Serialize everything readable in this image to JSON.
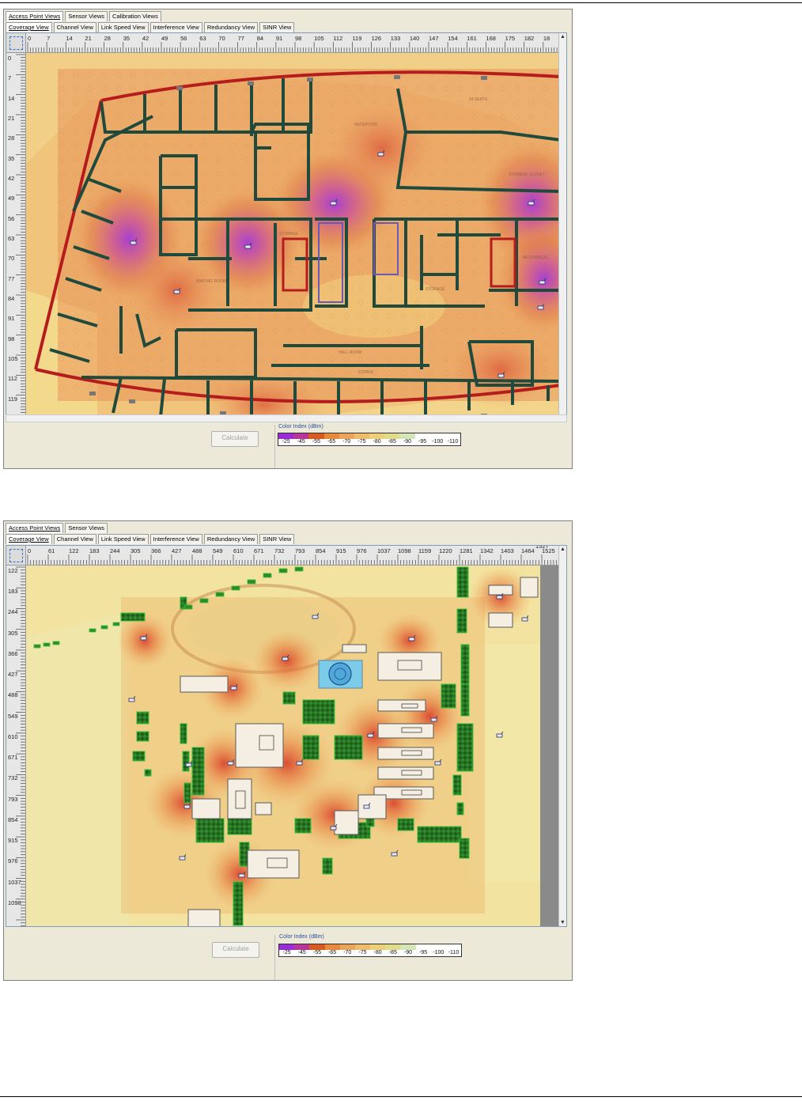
{
  "panel1": {
    "top_tabs": [
      {
        "label": "Access Point Views",
        "active": true
      },
      {
        "label": "Sensor Views",
        "active": false
      },
      {
        "label": "Calibration Views",
        "active": false
      }
    ],
    "sub_tabs": [
      {
        "label": "Coverage View",
        "active": true
      },
      {
        "label": "Channel View",
        "active": false
      },
      {
        "label": "Link Speed View",
        "active": false
      },
      {
        "label": "Interference View",
        "active": false
      },
      {
        "label": "Redundancy View",
        "active": false
      },
      {
        "label": "SINR View",
        "active": false
      }
    ],
    "h_ticks": [
      "0",
      "7",
      "14",
      "21",
      "28",
      "35",
      "42",
      "49",
      "56",
      "63",
      "70",
      "77",
      "84",
      "91",
      "98",
      "105",
      "112",
      "119",
      "126",
      "133",
      "140",
      "147",
      "154",
      "161",
      "168",
      "175",
      "182",
      "18"
    ],
    "v_ticks": [
      "0",
      "7",
      "14",
      "21",
      "28",
      "35",
      "42",
      "49",
      "56",
      "63",
      "70",
      "77",
      "84",
      "91",
      "98",
      "105",
      "112",
      "119"
    ],
    "calculate_label": "Calculate",
    "color_index_title": "Color Index (dBm)",
    "room_labels": [
      "RECEPTION",
      "24 SEATS",
      "STORAGE CLOSET",
      "MECHANICAL",
      "WAITING ROOM",
      "STORAGE",
      "STORAGE",
      "HALL ROOM",
      "COPIER"
    ]
  },
  "panel2": {
    "top_tabs": [
      {
        "label": "Access Point Views",
        "active": true
      },
      {
        "label": "Sensor Views",
        "active": false
      }
    ],
    "sub_tabs": [
      {
        "label": "Coverage View",
        "active": true
      },
      {
        "label": "Channel View",
        "active": false
      },
      {
        "label": "Link Speed View",
        "active": false
      },
      {
        "label": "Interference View",
        "active": false
      },
      {
        "label": "Redundancy View",
        "active": false
      },
      {
        "label": "SINR View",
        "active": false
      }
    ],
    "h_ticks": [
      "0",
      "61",
      "122",
      "183",
      "244",
      "305",
      "366",
      "427",
      "488",
      "549",
      "610",
      "671",
      "732",
      "793",
      "854",
      "915",
      "976",
      "1037",
      "1098",
      "1159",
      "1220",
      "1281",
      "1342",
      "1403",
      "1464",
      "1525"
    ],
    "h_tick_end": "1527",
    "v_ticks": [
      "122",
      "183",
      "244",
      "305",
      "366",
      "427",
      "488",
      "549",
      "610",
      "671",
      "732",
      "793",
      "854",
      "915",
      "976",
      "1037",
      "1098"
    ],
    "calculate_label": "Calculate",
    "color_index_title": "Color Index (dBm)"
  },
  "color_index": {
    "values": [
      "-25",
      "-45",
      "-55",
      "-65",
      "-70",
      "-75",
      "-80",
      "-85",
      "-90",
      "-95",
      "-100",
      "-110"
    ],
    "colors": [
      "#9a2bd6",
      "#b8369a",
      "#d95a1e",
      "#e88a3a",
      "#eca35a",
      "#efbd6a",
      "#eccf76",
      "#e2dc8a",
      "#d2e6b6",
      "#ffffff",
      "#ffffff",
      "#ffffff"
    ]
  },
  "icons": {
    "access_point": "access-point-icon",
    "sensor": "sensor-icon"
  }
}
